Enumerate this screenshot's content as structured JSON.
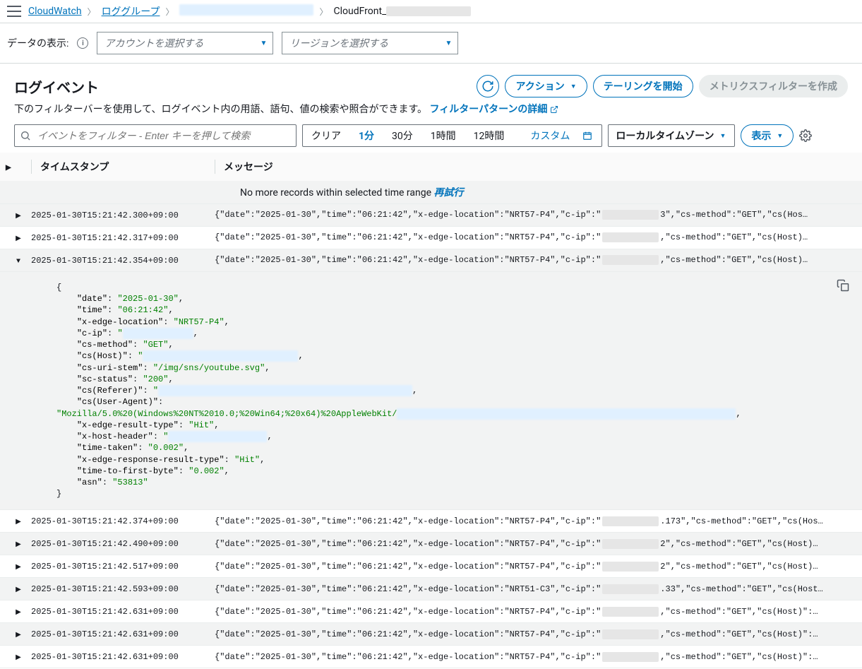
{
  "breadcrumb": {
    "root": "CloudWatch",
    "groups": "ロググループ",
    "current": "CloudFront_"
  },
  "dataview": {
    "label": "データの表示:",
    "account_ph": "アカウントを選択する",
    "region_ph": "リージョンを選択する"
  },
  "section": {
    "title": "ログイベント",
    "desc": "下のフィルターバーを使用して、ログイベント内の用語、語句、値の検索や照合ができます。",
    "filter_link": "フィルターパターンの詳細",
    "action": "アクション",
    "tailing": "テーリングを開始",
    "metrics": "メトリクスフィルターを作成"
  },
  "toolbar": {
    "search_ph": "イベントをフィルター - Enter キーを押して検索",
    "clear": "クリア",
    "t1": "1分",
    "t30": "30分",
    "t1h": "1時間",
    "t12h": "12時間",
    "custom": "カスタム",
    "tz": "ローカルタイムゾーン",
    "display": "表示"
  },
  "table": {
    "th_ts": "タイムスタンプ",
    "th_msg": "メッセージ",
    "no_records": "No more records within selected time range",
    "retry": "再試行"
  },
  "rows": [
    {
      "ts": "2025-01-30T15:21:42.300+09:00",
      "pre": "{\"date\":\"2025-01-30\",\"time\":\"06:21:42\",\"x-edge-location\":\"NRT57-P4\",\"c-ip\":\"",
      "post": "3\",\"cs-method\":\"GET\",\"cs(Hos…",
      "expanded": false
    },
    {
      "ts": "2025-01-30T15:21:42.317+09:00",
      "pre": "{\"date\":\"2025-01-30\",\"time\":\"06:21:42\",\"x-edge-location\":\"NRT57-P4\",\"c-ip\":\"",
      "post": ",\"cs-method\":\"GET\",\"cs(Host)…",
      "expanded": false
    },
    {
      "ts": "2025-01-30T15:21:42.354+09:00",
      "pre": "{\"date\":\"2025-01-30\",\"time\":\"06:21:42\",\"x-edge-location\":\"NRT57-P4\",\"c-ip\":\"",
      "post": ",\"cs-method\":\"GET\",\"cs(Host)…",
      "expanded": true
    },
    {
      "ts": "2025-01-30T15:21:42.374+09:00",
      "pre": "{\"date\":\"2025-01-30\",\"time\":\"06:21:42\",\"x-edge-location\":\"NRT57-P4\",\"c-ip\":\"",
      "post": ".173\",\"cs-method\":\"GET\",\"cs(Hos…",
      "expanded": false
    },
    {
      "ts": "2025-01-30T15:21:42.490+09:00",
      "pre": "{\"date\":\"2025-01-30\",\"time\":\"06:21:42\",\"x-edge-location\":\"NRT57-P4\",\"c-ip\":\"",
      "post": "2\",\"cs-method\":\"GET\",\"cs(Host)…",
      "expanded": false
    },
    {
      "ts": "2025-01-30T15:21:42.517+09:00",
      "pre": "{\"date\":\"2025-01-30\",\"time\":\"06:21:42\",\"x-edge-location\":\"NRT57-P4\",\"c-ip\":\"",
      "post": "2\",\"cs-method\":\"GET\",\"cs(Host)…",
      "expanded": false
    },
    {
      "ts": "2025-01-30T15:21:42.593+09:00",
      "pre": "{\"date\":\"2025-01-30\",\"time\":\"06:21:42\",\"x-edge-location\":\"NRT51-C3\",\"c-ip\":\"",
      "post": ".33\",\"cs-method\":\"GET\",\"cs(Host…",
      "expanded": false
    },
    {
      "ts": "2025-01-30T15:21:42.631+09:00",
      "pre": "{\"date\":\"2025-01-30\",\"time\":\"06:21:42\",\"x-edge-location\":\"NRT57-P4\",\"c-ip\":\"",
      "post": ",\"cs-method\":\"GET\",\"cs(Host)\":…",
      "expanded": false
    },
    {
      "ts": "2025-01-30T15:21:42.631+09:00",
      "pre": "{\"date\":\"2025-01-30\",\"time\":\"06:21:42\",\"x-edge-location\":\"NRT57-P4\",\"c-ip\":\"",
      "post": ",\"cs-method\":\"GET\",\"cs(Host)\":…",
      "expanded": false
    },
    {
      "ts": "2025-01-30T15:21:42.631+09:00",
      "pre": "{\"date\":\"2025-01-30\",\"time\":\"06:21:42\",\"x-edge-location\":\"NRT57-P4\",\"c-ip\":\"",
      "post": ",\"cs-method\":\"GET\",\"cs(Host)\":…",
      "expanded": false
    }
  ],
  "expanded_json": {
    "date": "2025-01-30",
    "time": "06:21:42",
    "x-edge-location": "NRT57-P4",
    "cs-method": "GET",
    "cs-uri-stem": "/img/sns/youtube.svg",
    "sc-status": "200",
    "cs-user-agent": "Mozilla/5.0%20(Windows%20NT%2010.0;%20Win64;%20x64)%20AppleWebKit/",
    "x-edge-result-type": "Hit",
    "time-taken": "0.002",
    "x-edge-response-result-type": "Hit",
    "time-to-first-byte": "0.002",
    "asn": "53813"
  }
}
